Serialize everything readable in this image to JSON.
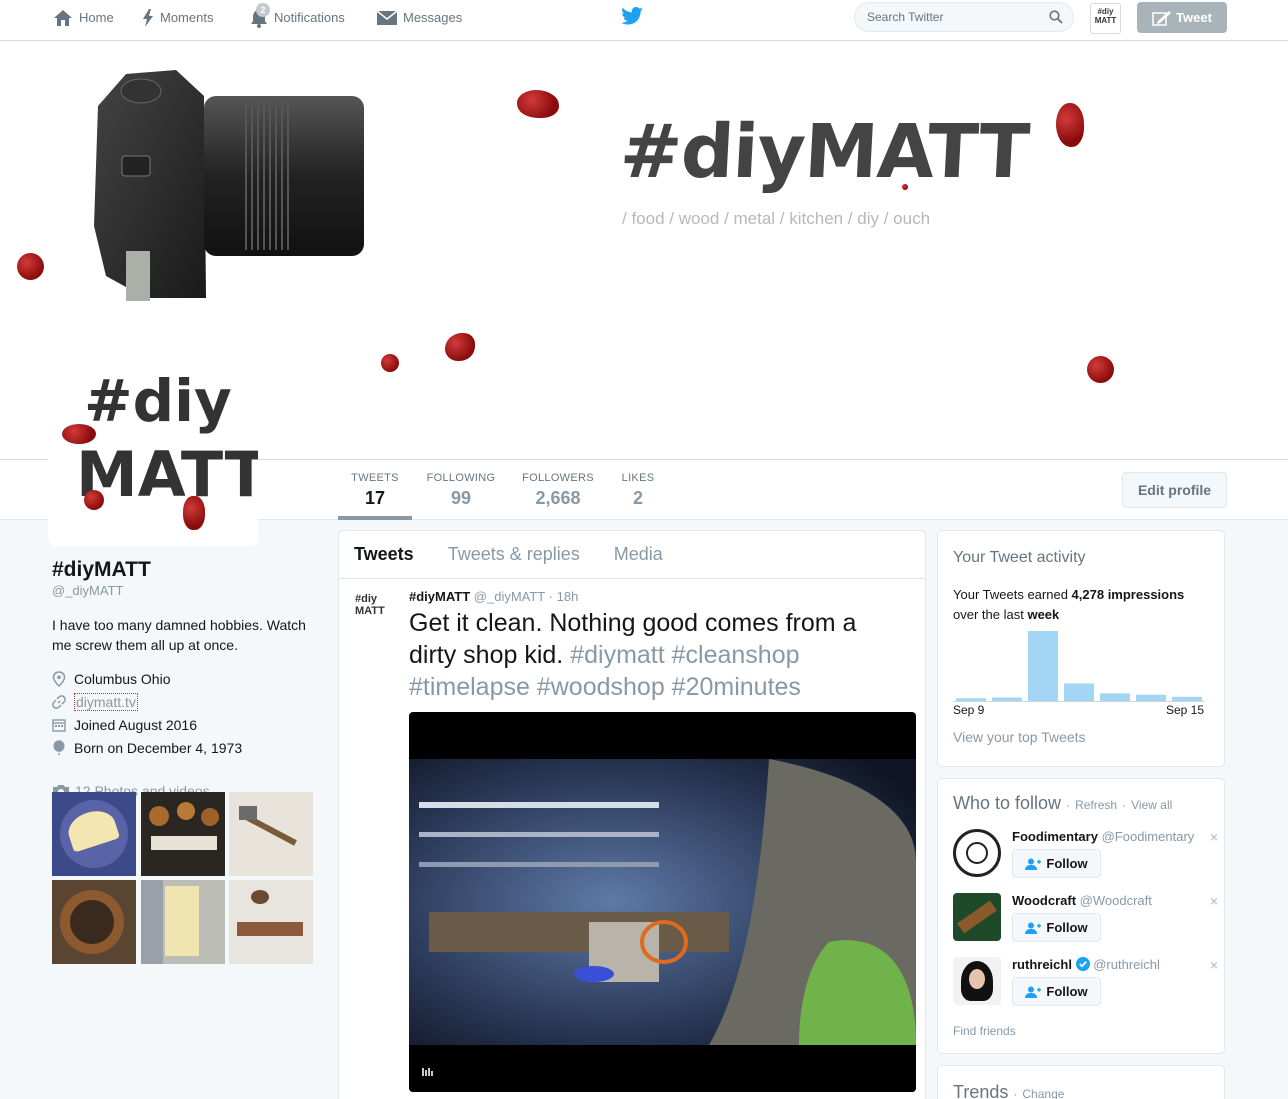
{
  "nav": {
    "home": "Home",
    "moments": "Moments",
    "notifications": "Notifications",
    "notifications_badge": "2",
    "messages": "Messages",
    "search_placeholder": "Search Twitter",
    "avatar_text": "#diy MATT",
    "tweet_button": "Tweet"
  },
  "banner": {
    "title": "#diyMATT",
    "subtitle": "/ food / wood / metal / kitchen / diy / ouch"
  },
  "avatar": {
    "line1": "#diy",
    "line2": "MATT"
  },
  "stats": [
    {
      "label": "TWEETS",
      "value": "17"
    },
    {
      "label": "FOLLOWING",
      "value": "99"
    },
    {
      "label": "FOLLOWERS",
      "value": "2,668"
    },
    {
      "label": "LIKES",
      "value": "2"
    }
  ],
  "edit_profile": "Edit profile",
  "profile": {
    "name": "#diyMATT",
    "handle": "@_diyMATT",
    "bio": "I have too many damned hobbies. Watch me screw them all up at once.",
    "location": "Columbus Ohio",
    "website": "diymatt.tv",
    "joined": "Joined August 2016",
    "born": "Born on December 4, 1973",
    "photos_label": "12 Photos and videos"
  },
  "timeline": {
    "tabs": [
      "Tweets",
      "Tweets & replies",
      "Media"
    ],
    "tweet": {
      "avatar_text": "#diy MATT",
      "name": "#diyMATT",
      "handle": "@_diyMATT",
      "sep": "·",
      "time": "18h",
      "text_plain": "Get it clean. Nothing good comes from a dirty shop kid.",
      "hashtags": "#diymatt #cleanshop #timelapse #woodshop #20minutes"
    }
  },
  "activity": {
    "title": "Your Tweet activity",
    "text_before": "Your Tweets earned",
    "impressions": "4,278 impressions",
    "text_mid": "over the last",
    "period": "week",
    "bars": [
      0.04,
      0.05,
      1.0,
      0.25,
      0.11,
      0.09,
      0.06
    ],
    "date_start": "Sep 9",
    "date_end": "Sep 15",
    "link": "View your top Tweets"
  },
  "who_to_follow": {
    "title": "Who to follow",
    "dot": "·",
    "refresh": "Refresh",
    "view_all": "View all",
    "follow_label": "Follow",
    "close": "×",
    "items": [
      {
        "name": "Foodimentary",
        "handle": "@Foodimentary"
      },
      {
        "name": "Woodcraft",
        "handle": "@Woodcraft"
      },
      {
        "name": "ruthreichl",
        "handle": "@ruthreichl"
      }
    ],
    "find_friends": "Find friends"
  },
  "trends": {
    "title": "Trends",
    "dot": "·",
    "change": "Change"
  },
  "colors": {
    "accent": "#1da1f2",
    "blood": "#9b0f0f",
    "muted": "#8899a6",
    "bar": "#a3d6f5"
  }
}
